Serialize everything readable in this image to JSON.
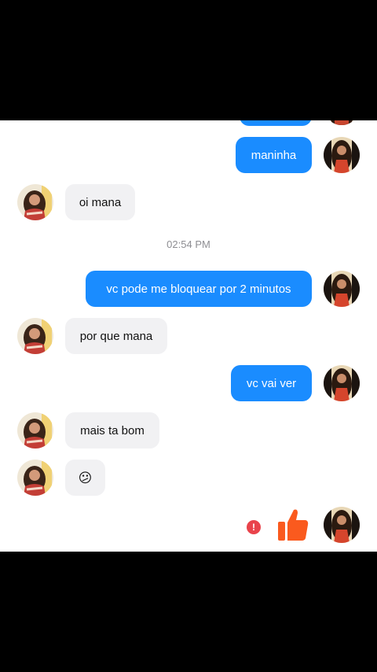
{
  "messages": {
    "m1": "maninha",
    "m2": "oi mana",
    "timestamp": "02:54 PM",
    "m3": "vc pode me bloquear por 2 minutos",
    "m4": "por que mana",
    "m5": "vc vai ver",
    "m6": "mais ta bom",
    "m7": "😕"
  },
  "status": {
    "error_mark": "!"
  },
  "icons": {
    "like": "thumbs-up-icon",
    "error": "error-badge-icon",
    "avatar": "avatar-photo"
  },
  "colors": {
    "outgoing_bubble": "#1a8cff",
    "incoming_bubble": "#f1f1f3",
    "like": "#fa5a1e",
    "error": "#e9434b"
  }
}
